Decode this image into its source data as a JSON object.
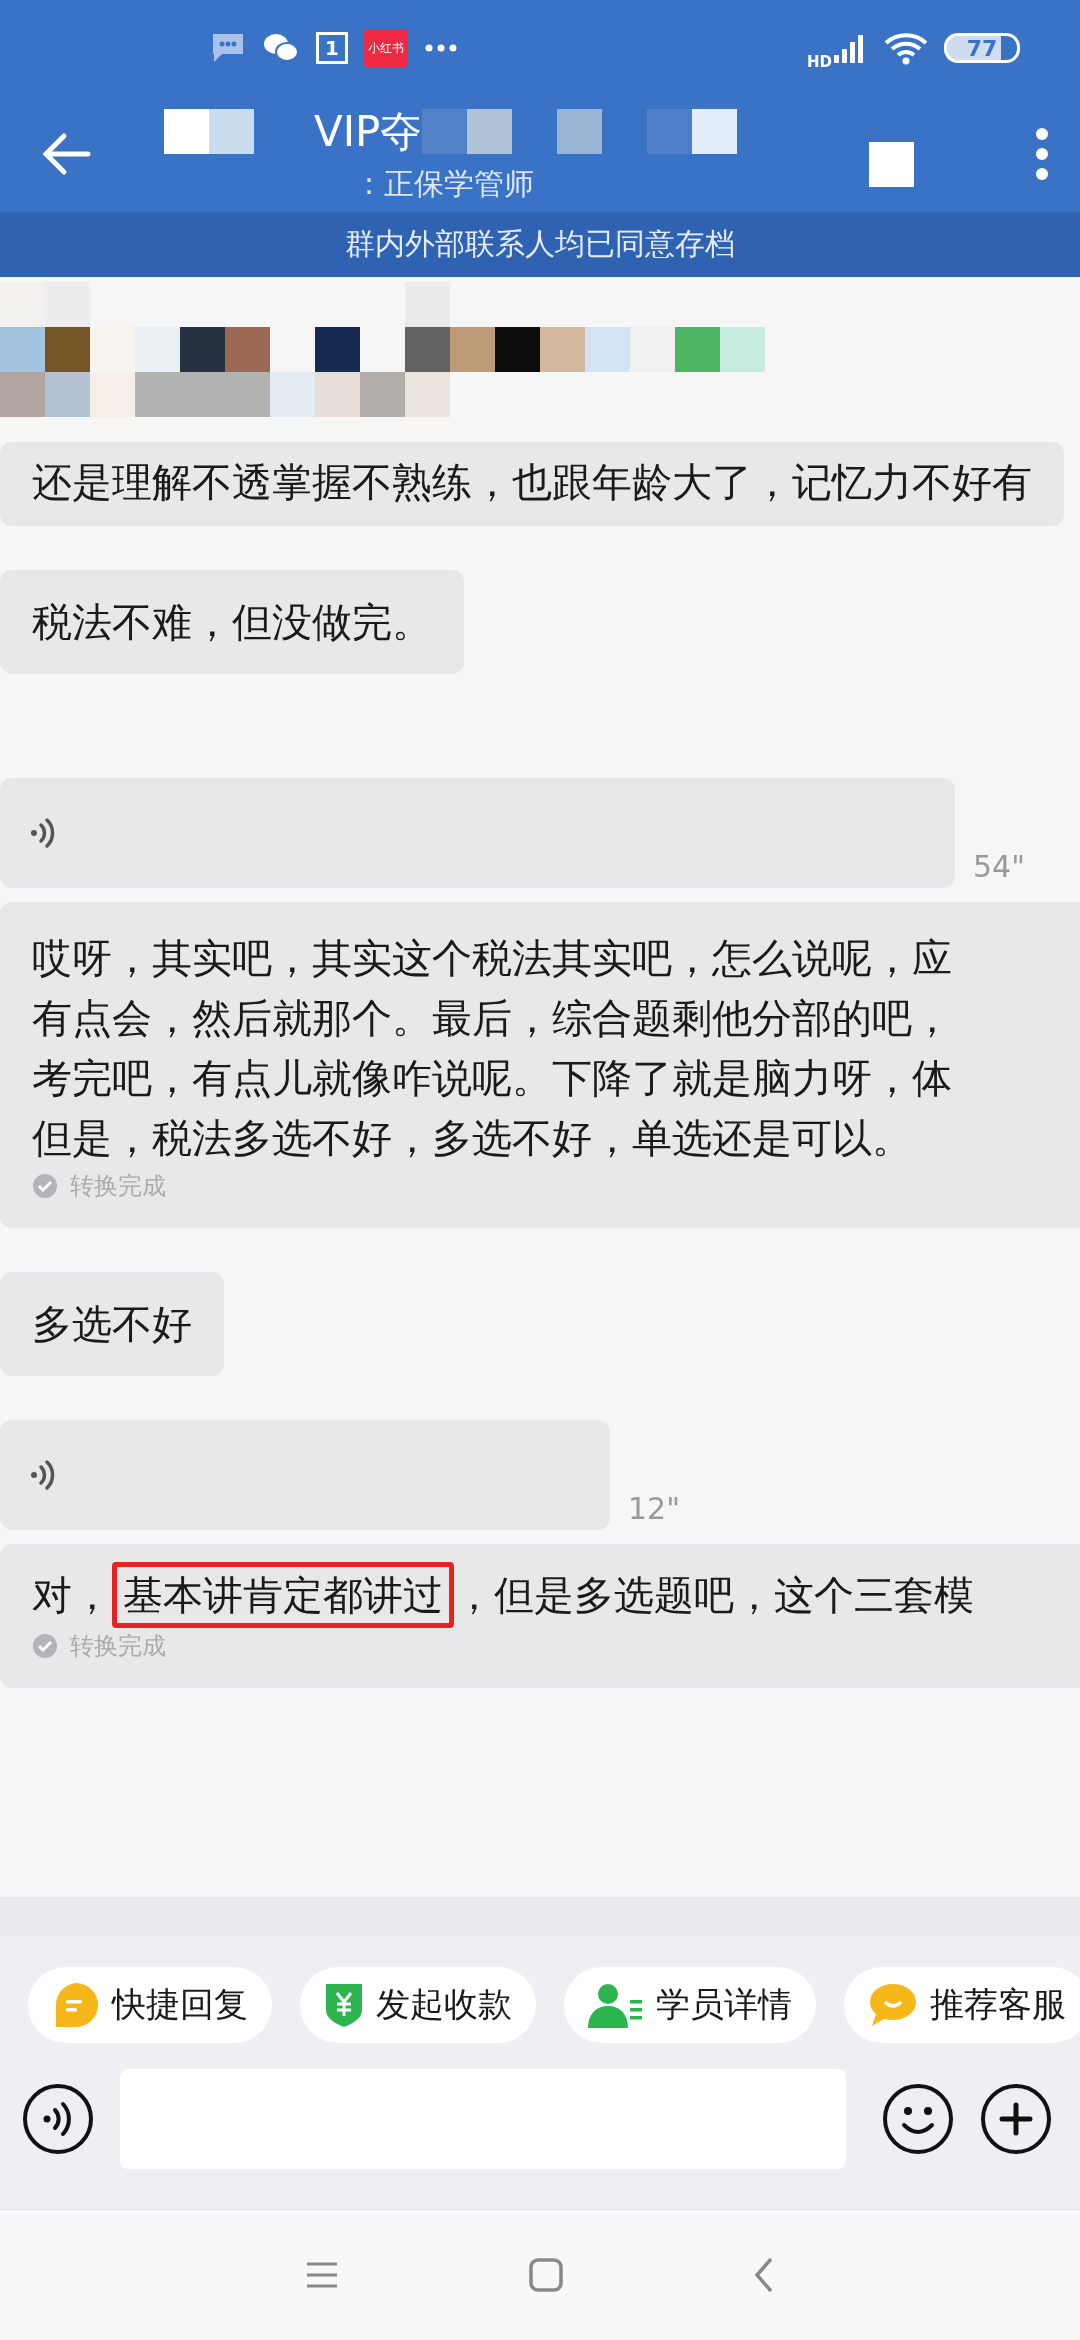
{
  "status_bar": {
    "calendar_day": "1",
    "app_badge": "小红书",
    "network": "HD",
    "battery": "77"
  },
  "header": {
    "title": "VIP夺",
    "subtitle": ": 正保学管师"
  },
  "banner": "群内外部联系人均已同意存档",
  "messages": [
    {
      "kind": "text",
      "lines": [
        "还是理解不透掌握不熟练，也跟年龄大了，记忆力不好有"
      ]
    },
    {
      "kind": "text",
      "lines": [
        "税法不难，但没做完。"
      ]
    },
    {
      "kind": "voice",
      "duration": "54\""
    },
    {
      "kind": "transcript",
      "lines": [
        "哎呀，其实吧，其实这个税法其实吧，怎么说呢，应",
        "有点会，然后就那个。最后，综合题剩他分部的吧，",
        "考完吧，有点儿就像咋说呢。下降了就是脑力呀，体",
        "但是，税法多选不好，多选不好，单选还是可以。"
      ],
      "status": "转换完成"
    },
    {
      "kind": "text",
      "lines": [
        "多选不好"
      ]
    },
    {
      "kind": "voice",
      "duration": "12\""
    },
    {
      "kind": "highlight",
      "prefix": "对，",
      "highlight": "基本讲肯定都讲过",
      "suffix": "，但是多选题吧，这个三套模",
      "status": "转换完成"
    }
  ],
  "quick_actions": [
    {
      "label": "快捷回复",
      "kind": "reply"
    },
    {
      "label": "发起收款",
      "kind": "payment"
    },
    {
      "label": "学员详情",
      "kind": "student"
    },
    {
      "label": "推荐客服",
      "kind": "service"
    }
  ]
}
